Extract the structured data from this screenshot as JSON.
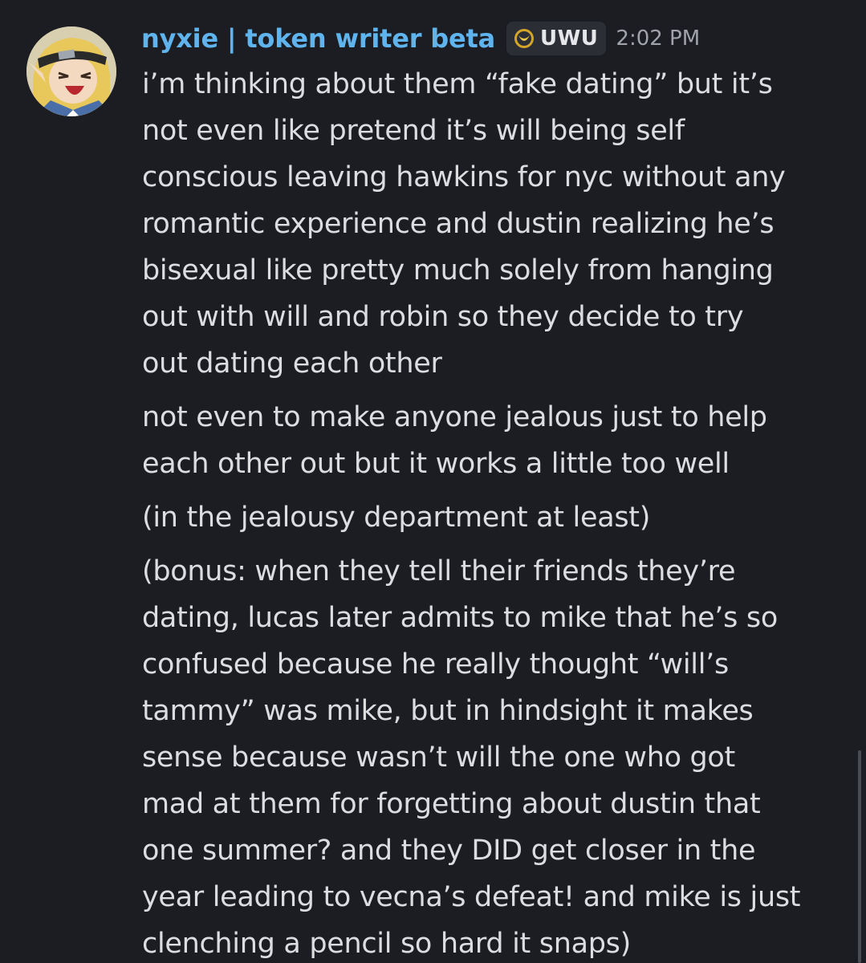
{
  "message": {
    "username": "nyxie | token writer beta",
    "tag": {
      "label": "UWU",
      "icon": "moon-badge-icon"
    },
    "timestamp": "2:02 PM",
    "paragraphs": [
      {
        "lines": [
          "i’m thinking about them “fake dating” but it’s",
          "not even like pretend it’s will being self",
          "conscious leaving hawkins for nyc without any",
          "romantic experience and dustin realizing he’s",
          "bisexual like pretty much solely from hanging",
          "out with will and robin so they decide to try",
          "out dating each other"
        ]
      },
      {
        "lines": [
          "not even to make anyone jealous just to help",
          "each other out but it works a little too well"
        ]
      },
      {
        "lines": [
          "(in the jealousy department at least)"
        ]
      },
      {
        "lines": [
          "(bonus: when they tell their friends they’re",
          "dating, lucas later admits to mike that he’s so",
          "confused because he really thought “will’s",
          "tammy” was mike, but in hindsight it makes",
          "sense because wasn’t will the one who got",
          "mad at them for forgetting about dustin that",
          "one summer? and they DID get closer in the",
          "year leading to vecna’s defeat! and mike is just",
          "clenching a pencil so hard it snaps)"
        ]
      }
    ]
  },
  "colors": {
    "background": "#1c1d22",
    "username": "#5fb4ee",
    "text": "#dcdde0",
    "timestamp": "#a0a3aa",
    "tag_bg": "#2c2e35"
  }
}
